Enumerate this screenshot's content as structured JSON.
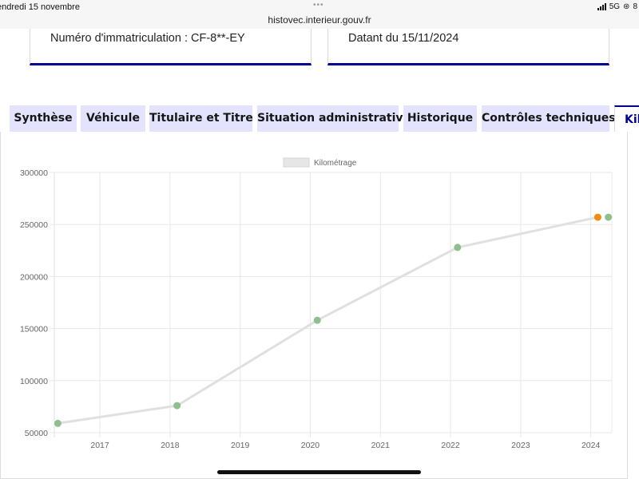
{
  "statusbar": {
    "time": "endredi 15 novembre",
    "url": "histovec.interieur.gouv.fr",
    "network": "5G",
    "battery": "8"
  },
  "cards": [
    {
      "label": "Numéro d'immatriculation : CF-8**-EY"
    },
    {
      "label": "Datant du 15/11/2024"
    }
  ],
  "tabs": [
    {
      "label": "Synthèse"
    },
    {
      "label": "Véhicule"
    },
    {
      "label": "Titulaire et Titre"
    },
    {
      "label": "Situation administrative"
    },
    {
      "label": "Historique"
    },
    {
      "label": "Contrôles techniques"
    },
    {
      "label": "Kil"
    }
  ],
  "active_tab": 6,
  "colors": {
    "tab_bg": "#e3e3fd",
    "accent": "#000091",
    "line": "#e0e0e0",
    "point": "#8fbf8f",
    "point_highlight": "#f08c14"
  },
  "chart_data": {
    "type": "line",
    "legend": "Kilométrage",
    "x_ticks": [
      "2017",
      "2018",
      "2019",
      "2020",
      "2021",
      "2022",
      "2023",
      "2024"
    ],
    "y_ticks": [
      "50000",
      "100000",
      "150000",
      "200000",
      "250000",
      "300000"
    ],
    "xlim": [
      2016.35,
      2024.3
    ],
    "ylim": [
      50000,
      300000
    ],
    "grid": true,
    "points": [
      {
        "x": 2016.4,
        "y": 59000
      },
      {
        "x": 2018.1,
        "y": 76000
      },
      {
        "x": 2020.1,
        "y": 158000
      },
      {
        "x": 2022.1,
        "y": 228000
      },
      {
        "x": 2024.1,
        "y": 257000
      },
      {
        "x": 2024.25,
        "y": 257000
      }
    ],
    "highlighted_point": 4
  }
}
